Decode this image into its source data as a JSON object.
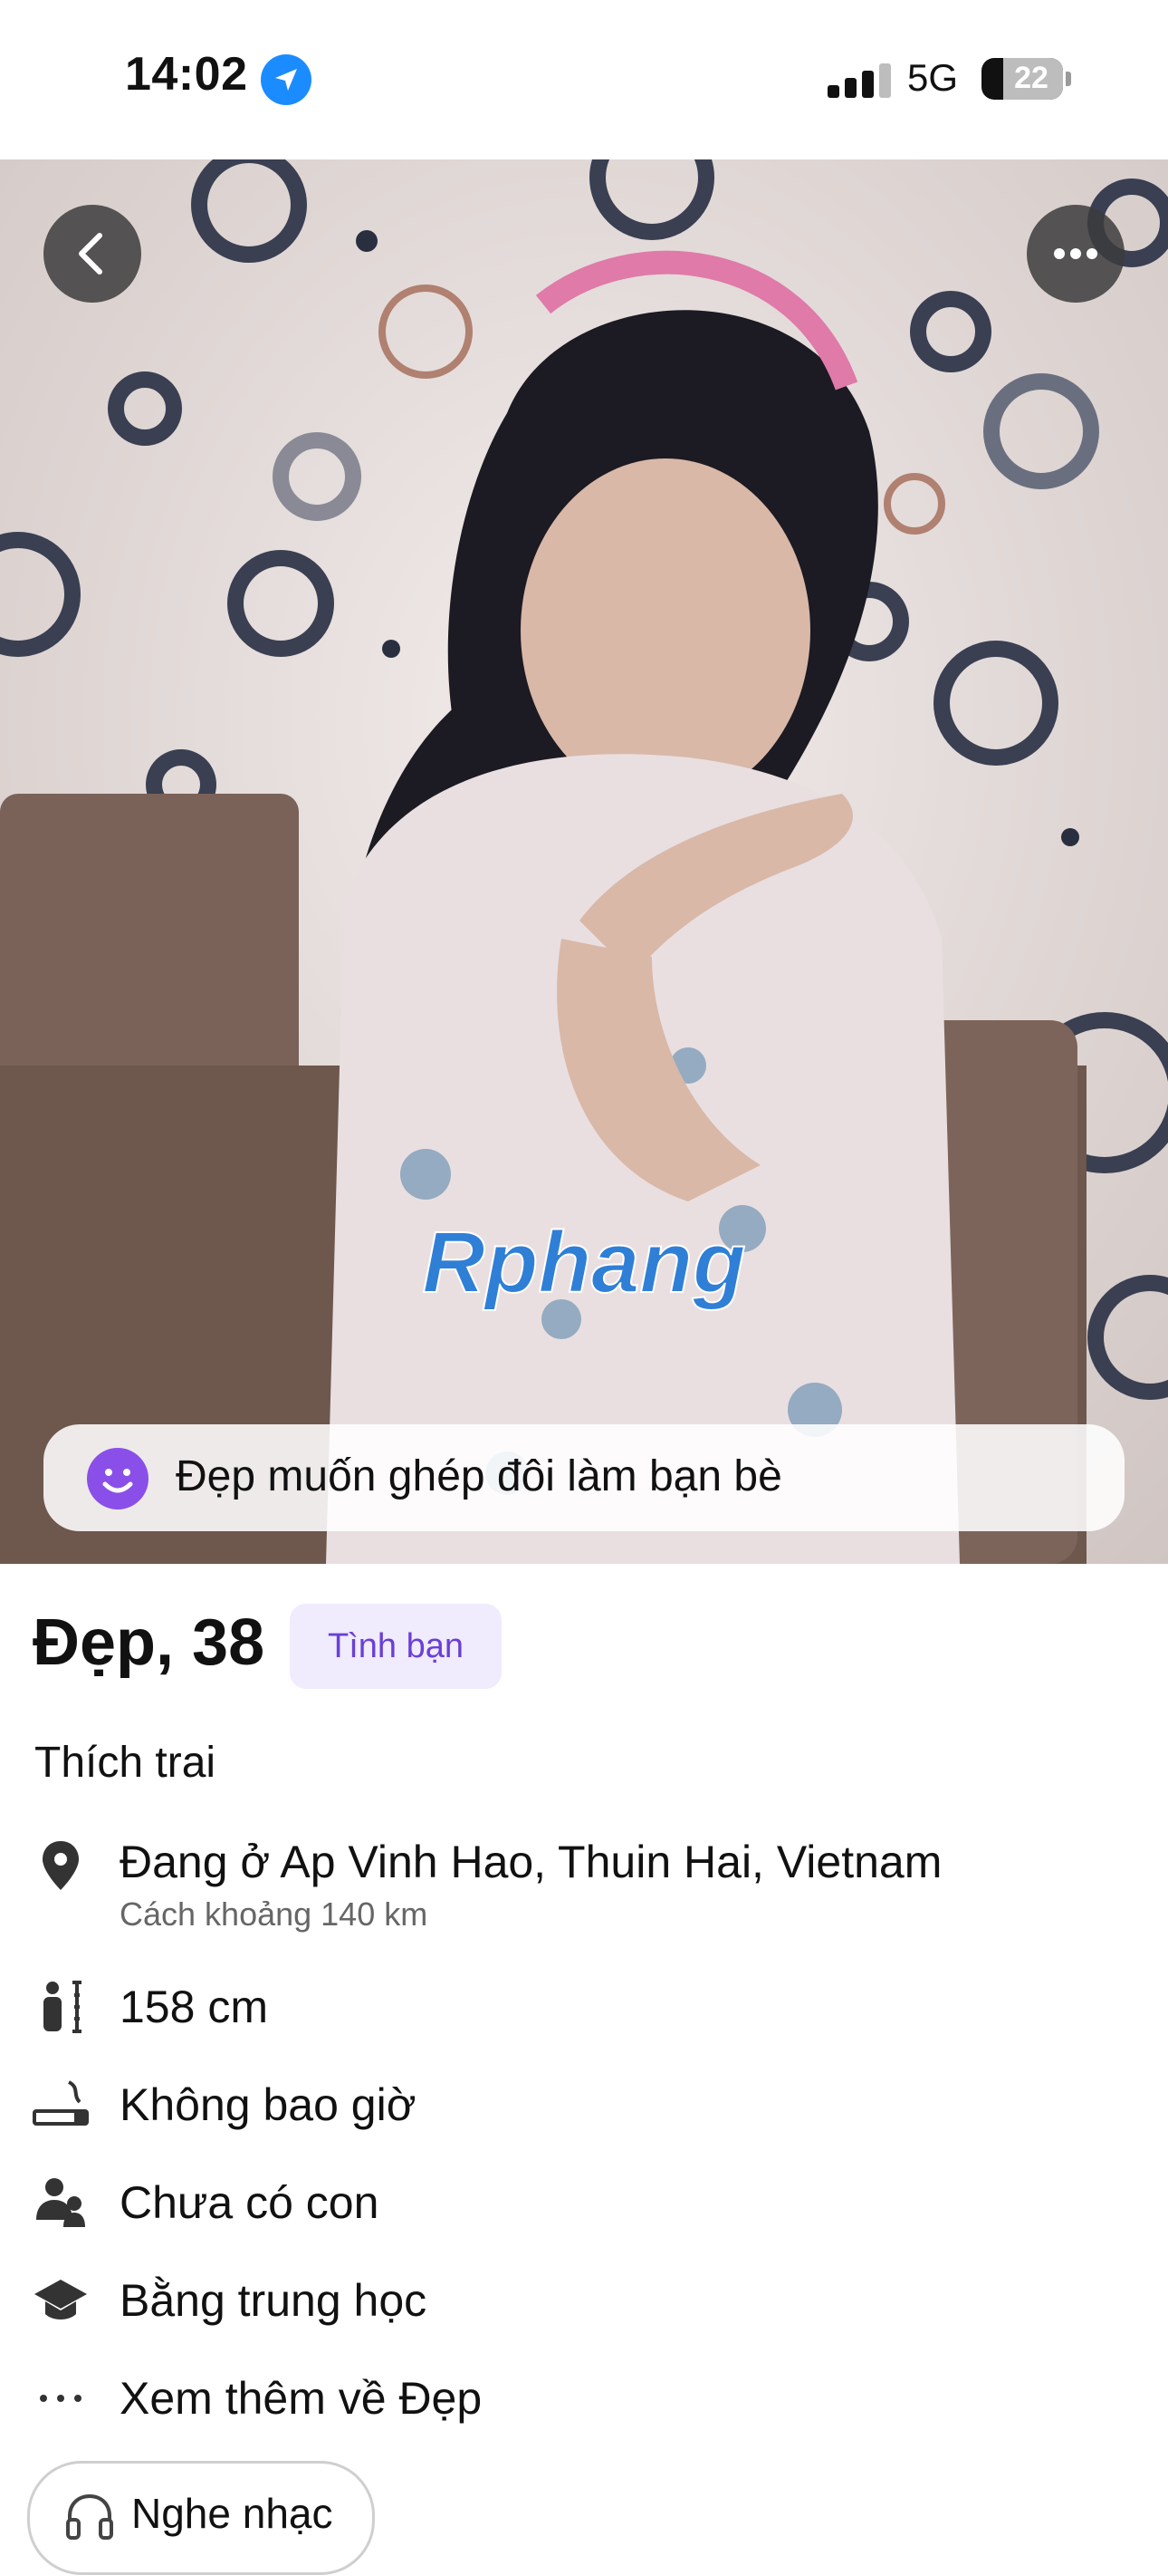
{
  "status_bar": {
    "time": "14:02",
    "network": "5G",
    "battery": "22"
  },
  "photo": {
    "watermark": "Rphang",
    "back_icon": "chevron-left-icon",
    "more_icon": "more-dots-icon",
    "prompt_text": "Đẹp muốn ghép đôi làm bạn bè",
    "prompt_icon": "smile-icon"
  },
  "profile": {
    "name_age": "Đẹp, 38",
    "tag": "Tình bạn",
    "preference": "Thích trai",
    "details": [
      {
        "icon": "location-pin-icon",
        "label": "Đang ở Ap Vinh Hao, Thuin Hai, Vietnam",
        "sub": "Cách  khoảng 140 km"
      },
      {
        "icon": "height-icon",
        "label": "158 cm"
      },
      {
        "icon": "smoking-icon",
        "label": "Không bao giờ"
      },
      {
        "icon": "children-icon",
        "label": "Chưa có con"
      },
      {
        "icon": "education-icon",
        "label": "Bằng trung học"
      },
      {
        "icon": "more-dots-icon",
        "label": "Xem thêm về Đẹp"
      }
    ],
    "interest": {
      "icon": "headphones-icon",
      "label": "Nghe nhạc"
    }
  },
  "colors": {
    "accent": "#8a4fe8",
    "chip_bg": "#f0ebfd",
    "chip_text": "#6a3fd6",
    "location": "#1a8cff"
  }
}
